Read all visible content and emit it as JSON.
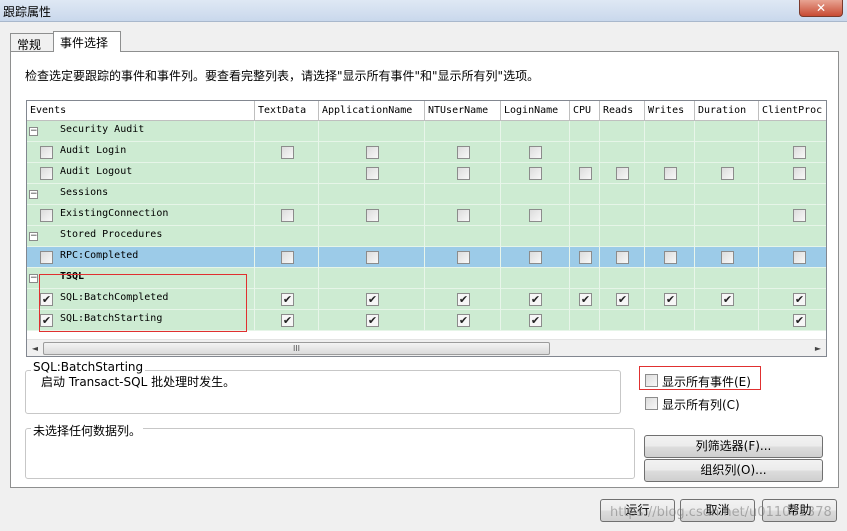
{
  "window": {
    "title": "跟踪属性",
    "close_glyph": "✕"
  },
  "tabs": [
    {
      "label": "常规"
    },
    {
      "label": "事件选择"
    }
  ],
  "description": "检查选定要跟踪的事件和事件列。要查看完整列表，请选择\"显示所有事件\"和\"显示所有列\"选项。",
  "grid": {
    "columns": [
      "Events",
      "TextData",
      "ApplicationName",
      "NTUserName",
      "LoginName",
      "CPU",
      "Reads",
      "Writes",
      "Duration",
      "ClientProc"
    ],
    "rows": [
      {
        "type": "category",
        "label": "Security Audit",
        "bold": false,
        "cells": []
      },
      {
        "type": "event",
        "label": "Audit Login",
        "checked": false,
        "selected": false,
        "cells": [
          "off",
          "off",
          "off",
          "off",
          "",
          "",
          "",
          "",
          "off"
        ]
      },
      {
        "type": "event",
        "label": "Audit Logout",
        "checked": false,
        "selected": false,
        "cells": [
          "",
          "off",
          "off",
          "off",
          "off",
          "off",
          "off",
          "off",
          "off"
        ]
      },
      {
        "type": "category",
        "label": "Sessions",
        "bold": false,
        "cells": []
      },
      {
        "type": "event",
        "label": "ExistingConnection",
        "checked": false,
        "selected": false,
        "cells": [
          "off",
          "off",
          "off",
          "off",
          "",
          "",
          "",
          "",
          "off"
        ]
      },
      {
        "type": "category",
        "label": "Stored Procedures",
        "bold": false,
        "cells": []
      },
      {
        "type": "event",
        "label": "RPC:Completed",
        "checked": false,
        "selected": true,
        "cells": [
          "off",
          "off",
          "off",
          "off",
          "off",
          "off",
          "off",
          "off",
          "off"
        ]
      },
      {
        "type": "category",
        "label": "TSQL",
        "bold": true,
        "cells": []
      },
      {
        "type": "event",
        "label": "SQL:BatchCompleted",
        "checked": true,
        "selected": false,
        "cells": [
          "on",
          "on",
          "on",
          "on",
          "on",
          "on",
          "on",
          "on",
          "on"
        ]
      },
      {
        "type": "event",
        "label": "SQL:BatchStarting",
        "checked": true,
        "selected": false,
        "cells": [
          "on",
          "on",
          "on",
          "on",
          "",
          "",
          "",
          "",
          "on"
        ]
      }
    ],
    "scroll_thumb_glyph": "III",
    "scroll_left_glyph": "◄",
    "scroll_right_glyph": "►"
  },
  "event_info": {
    "title": "SQL:BatchStarting",
    "text": "启动 Transact-SQL 批处理时发生。"
  },
  "column_info": {
    "text": "未选择任何数据列。"
  },
  "options": {
    "show_all_events": {
      "label": "显示所有事件(E)",
      "checked": false
    },
    "show_all_columns": {
      "label": "显示所有列(C)",
      "checked": false
    }
  },
  "buttons": {
    "column_filter": "列筛选器(F)...",
    "organize_columns": "组织列(O)...",
    "run": "运行",
    "cancel": "取消",
    "help": "帮助"
  },
  "watermark": "https://blog.csdn.net/u011001378",
  "colors": {
    "row_green": "#cdebd2",
    "row_selected": "#9ccbe8",
    "highlight_red": "#e03030"
  }
}
